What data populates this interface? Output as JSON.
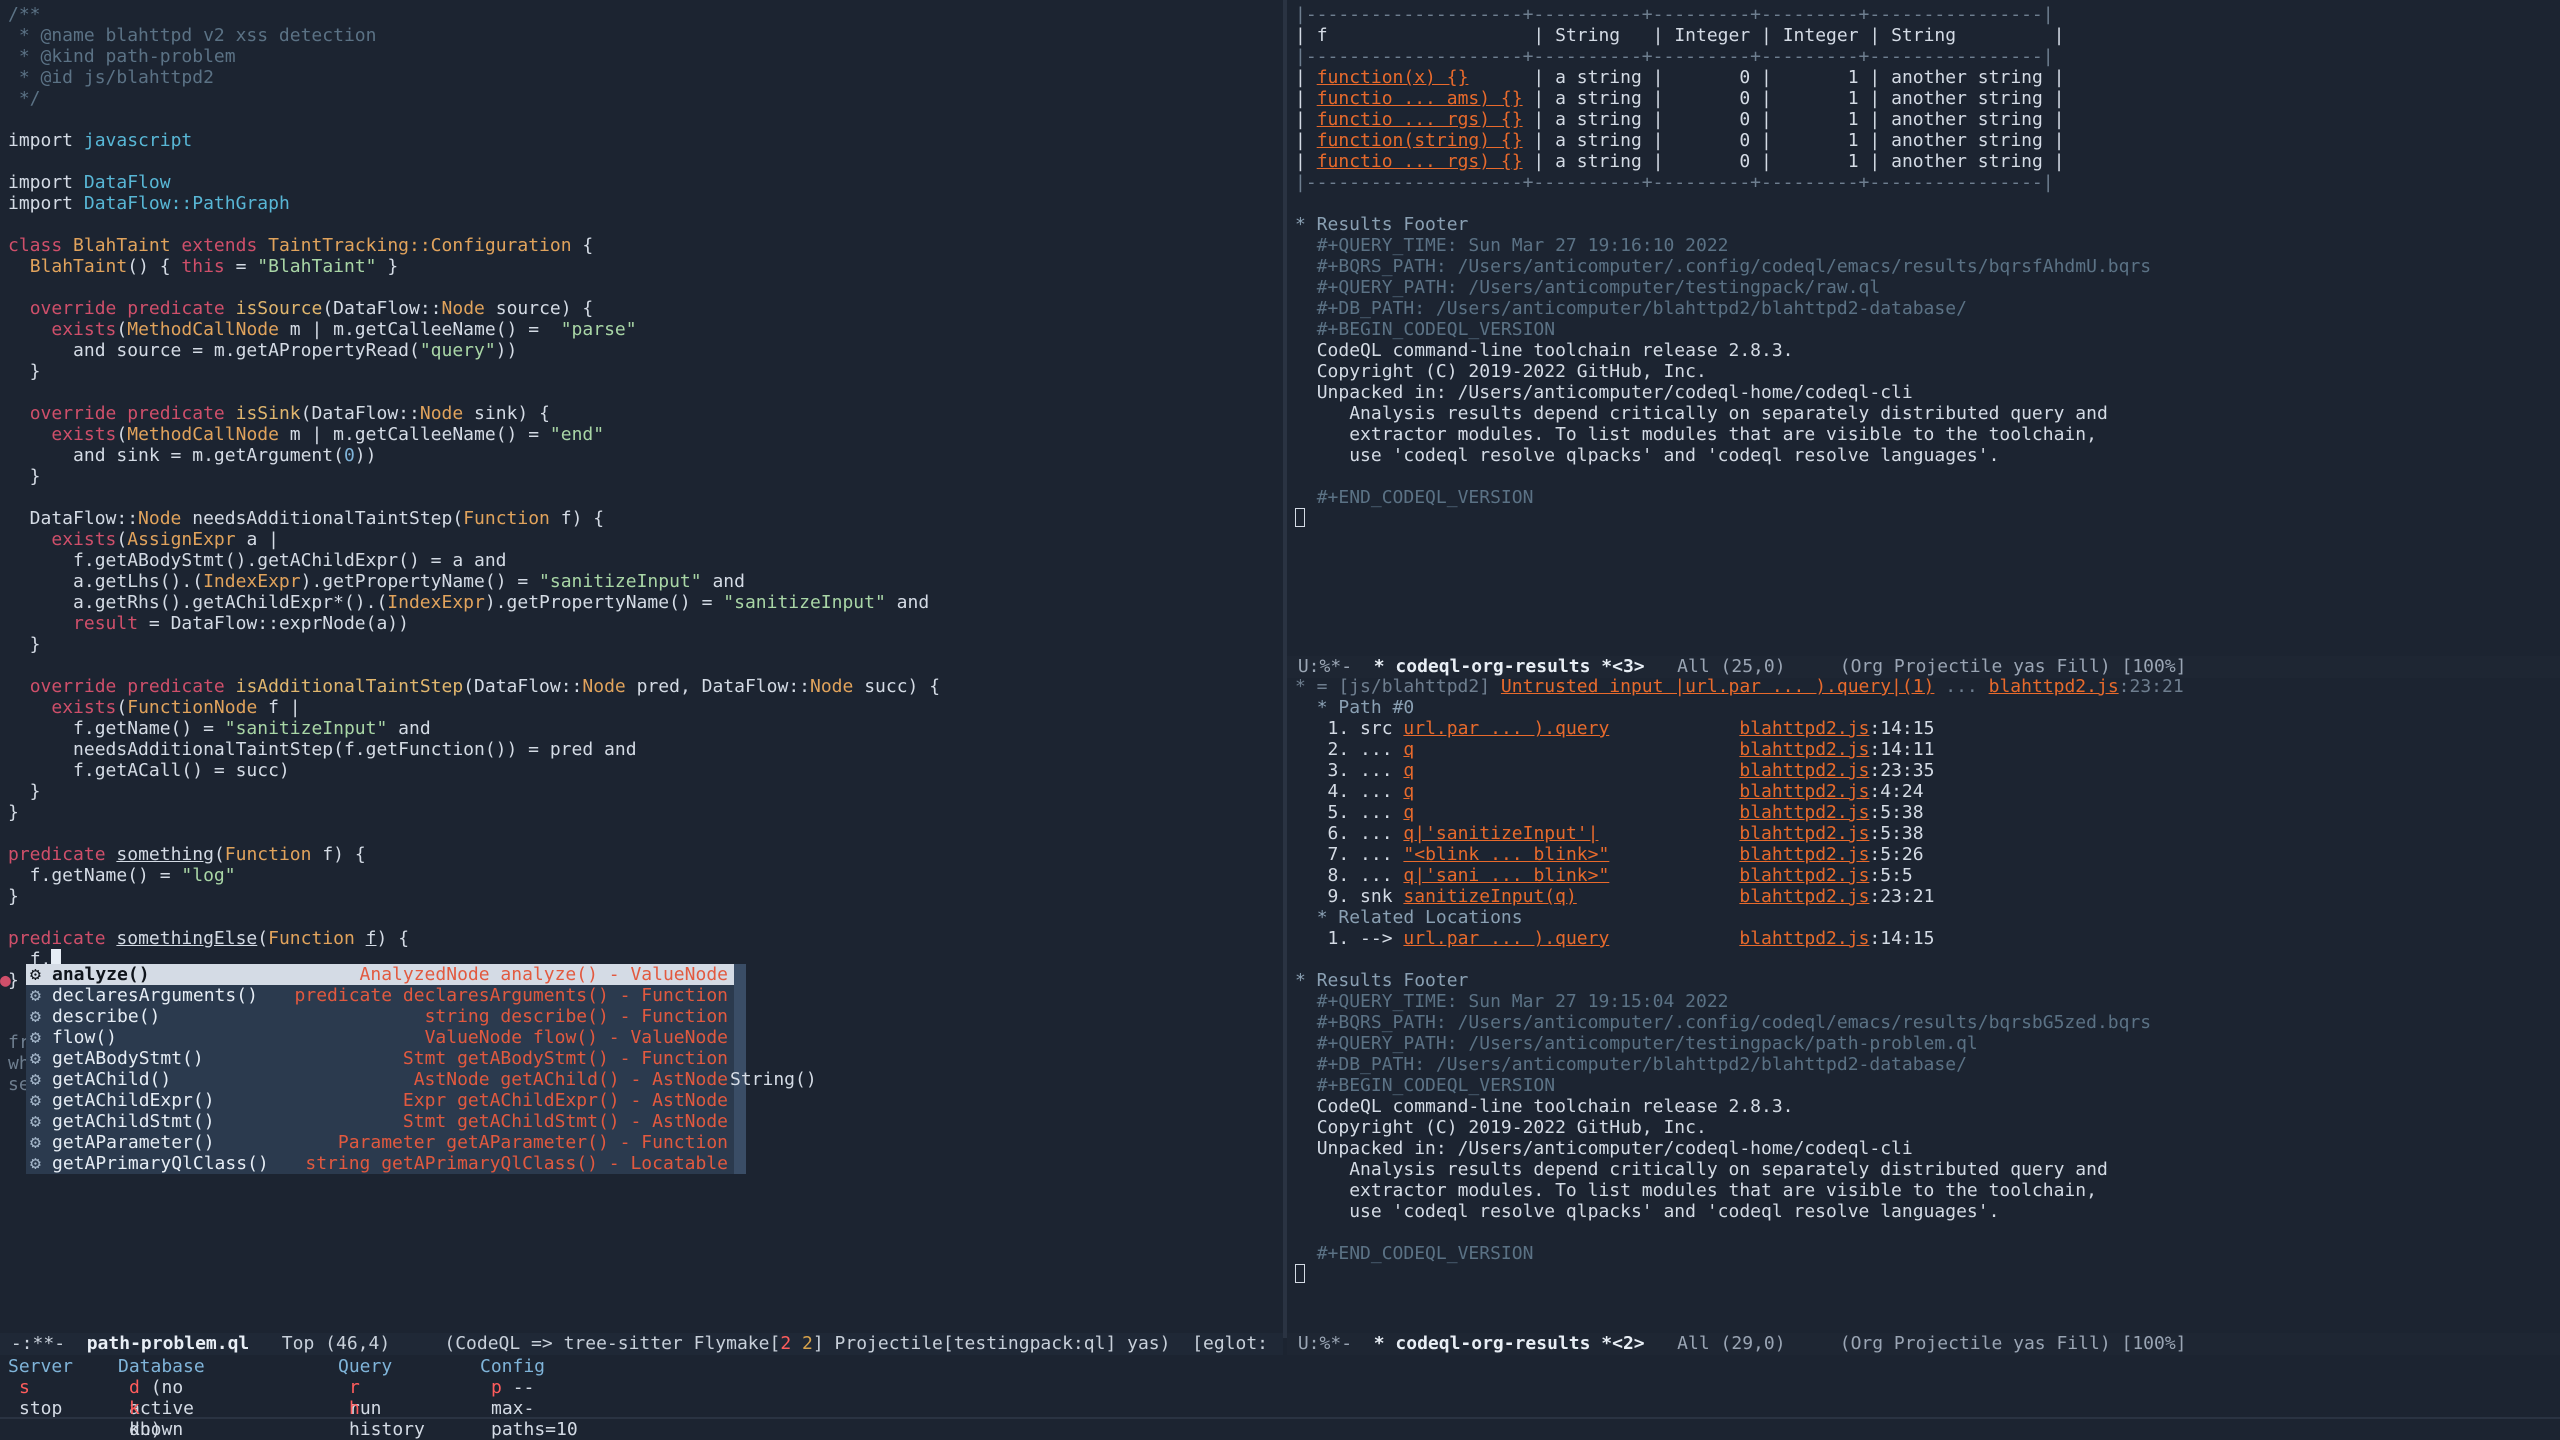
{
  "editor": {
    "header": [
      "/**",
      " * @name blahttpd v2 xss detection",
      " * @kind path-problem",
      " * @id js/blahttpd2",
      " */"
    ],
    "import_kw": "import",
    "imports": [
      "javascript",
      "DataFlow",
      "DataFlow::PathGraph"
    ],
    "class_name": "BlahTaint",
    "extends_type": "TaintTracking::Configuration",
    "taint_string": "\"BlahTaint\"",
    "is_source": "isSource",
    "is_sink": "isSink",
    "needs_step": "needsAdditionalTaintStep",
    "is_additional": "isAdditionalTaintStep",
    "parse_str": "\"parse\"",
    "query_str": "\"query\"",
    "end_str": "\"end\"",
    "sanitize_str": "\"sanitizeInput\"",
    "log_str": "\"log\"",
    "something": "something",
    "something_else": "somethingElse",
    "typed_prefix": "f."
  },
  "completion": {
    "items": [
      {
        "label": "analyze()",
        "ann": "AnalyzedNode analyze() - ValueNode",
        "selected": true
      },
      {
        "label": "declaresArguments()",
        "ann": "predicate declaresArguments() - Function"
      },
      {
        "label": "describe()",
        "ann": "string describe() - Function"
      },
      {
        "label": "flow()",
        "ann": "ValueNode flow() - ValueNode"
      },
      {
        "label": "getABodyStmt()",
        "ann": "Stmt getABodyStmt() - Function"
      },
      {
        "label": "getAChild()",
        "ann": "AstNode getAChild() - AstNode"
      },
      {
        "label": "getAChildExpr()",
        "ann": "Expr getAChildExpr() - AstNode"
      },
      {
        "label": "getAChildStmt()",
        "ann": "Stmt getAChildStmt() - AstNode"
      },
      {
        "label": "getAParameter()",
        "ann": "Parameter getAParameter() - Function"
      },
      {
        "label": "getAPrimaryQlClass()",
        "ann": "string getAPrimaryQlClass() - Locatable"
      }
    ],
    "side_text": "String()",
    "gutter_left": [
      "fr",
      "wh",
      "se"
    ]
  },
  "results_table": {
    "border_top": "|--------------------+----------+---------+---------+----------------|",
    "headers": [
      "f",
      "String",
      "Integer",
      "Integer",
      "String"
    ],
    "rows": [
      [
        "function(x) {}",
        "a string",
        "0",
        "1",
        "another string"
      ],
      [
        "functio ... ams) {}",
        "a string",
        "0",
        "1",
        "another string"
      ],
      [
        "functio ... rgs) {}",
        "a string",
        "0",
        "1",
        "another string"
      ],
      [
        "function(string) {}",
        "a string",
        "0",
        "1",
        "another string"
      ],
      [
        "functio ... rgs) {}",
        "a string",
        "0",
        "1",
        "another string"
      ]
    ]
  },
  "footer1": {
    "heading": "* Results Footer",
    "meta": [
      "#+QUERY_TIME: Sun Mar 27 19:16:10 2022",
      "#+BQRS_PATH: /Users/anticomputer/.config/codeql/emacs/results/bqrsfAhdmU.bqrs",
      "#+QUERY_PATH: /Users/anticomputer/testingpack/raw.ql",
      "#+DB_PATH: /Users/anticomputer/blahttpd2/blahttpd2-database/",
      "#+BEGIN_CODEQL_VERSION"
    ],
    "version": [
      "CodeQL command-line toolchain release 2.8.3.",
      "Copyright (C) 2019-2022 GitHub, Inc.",
      "Unpacked in: /Users/anticomputer/codeql-home/codeql-cli",
      "   Analysis results depend critically on separately distributed query and",
      "   extractor modules. To list modules that are visible to the toolchain,",
      "   use 'codeql resolve qlpacks' and 'codeql resolve languages'."
    ],
    "end": "#+END_CODEQL_VERSION"
  },
  "modeline_rtop": {
    "status": "U:%*-",
    "buffer": "* codeql-org-results *<3>",
    "pos": "All (25,0)",
    "modes": "(Org Projectile yas Fill) [100%]"
  },
  "path_results": {
    "title_prefix": "* = [js/blahttpd2]",
    "title_link": "Untrusted input |url.par ... ).query|(1)",
    "title_mid": "...",
    "title_file": "blahttpd2.js",
    "title_loc": ":23:21",
    "path_heading": "* Path #0",
    "steps": [
      {
        "n": "1.",
        "kind": "src",
        "node": "url.par ... ).query",
        "file": "blahttpd2.js",
        "loc": ":14:15"
      },
      {
        "n": "2.",
        "kind": "...",
        "node": "q",
        "file": "blahttpd2.js",
        "loc": ":14:11"
      },
      {
        "n": "3.",
        "kind": "...",
        "node": "q",
        "file": "blahttpd2.js",
        "loc": ":23:35"
      },
      {
        "n": "4.",
        "kind": "...",
        "node": "q",
        "file": "blahttpd2.js",
        "loc": ":4:24"
      },
      {
        "n": "5.",
        "kind": "...",
        "node": "q",
        "file": "blahttpd2.js",
        "loc": ":5:38"
      },
      {
        "n": "6.",
        "kind": "...",
        "node": "q|'sanitizeInput'|",
        "file": "blahttpd2.js",
        "loc": ":5:38"
      },
      {
        "n": "7.",
        "kind": "...",
        "node": "\"<blink ... blink>\"",
        "file": "blahttpd2.js",
        "loc": ":5:26"
      },
      {
        "n": "8.",
        "kind": "...",
        "node": "q|'sani ... blink>\"",
        "file": "blahttpd2.js",
        "loc": ":5:5"
      },
      {
        "n": "9.",
        "kind": "snk",
        "node": "sanitizeInput(q)",
        "file": "blahttpd2.js",
        "loc": ":23:21"
      }
    ],
    "related_heading": "* Related Locations",
    "related": [
      {
        "n": "1.",
        "kind": "-->",
        "node": "url.par ... ).query",
        "file": "blahttpd2.js",
        "loc": ":14:15"
      }
    ]
  },
  "footer2": {
    "heading": "* Results Footer",
    "meta": [
      "#+QUERY_TIME: Sun Mar 27 19:15:04 2022",
      "#+BQRS_PATH: /Users/anticomputer/.config/codeql/emacs/results/bqrsbG5zed.bqrs",
      "#+QUERY_PATH: /Users/anticomputer/testingpack/path-problem.ql",
      "#+DB_PATH: /Users/anticomputer/blahttpd2/blahttpd2-database/",
      "#+BEGIN_CODEQL_VERSION"
    ],
    "end": "#+END_CODEQL_VERSION"
  },
  "modeline_left": {
    "status": "-:**-",
    "buffer": "path-problem.ql",
    "pos": "Top (46,4)",
    "modes_a": "(CodeQL => tree-sitter Flymake[",
    "flymake_err": "2",
    "flymake_warn": "2",
    "modes_b": "] Projectile[testingpack:ql] yas)",
    "eglot": "[eglot:"
  },
  "modeline_rbot": {
    "status": "U:%*-",
    "buffer": "* codeql-org-results *<2>",
    "pos": "All (29,0)",
    "modes": "(Org Projectile yas Fill) [100%]"
  },
  "transient": {
    "headers": [
      "Server",
      "Database",
      "Query",
      "Config"
    ],
    "s_key": "s",
    "s_label": "stop",
    "d_key": "d",
    "d_label": "(no active db)",
    "k_key": "k",
    "k_label": "known",
    "r_key": "r",
    "r_label": "run",
    "h_key": "h",
    "h_label": "history",
    "p_key": "p",
    "p_label": "--max-paths=10"
  }
}
